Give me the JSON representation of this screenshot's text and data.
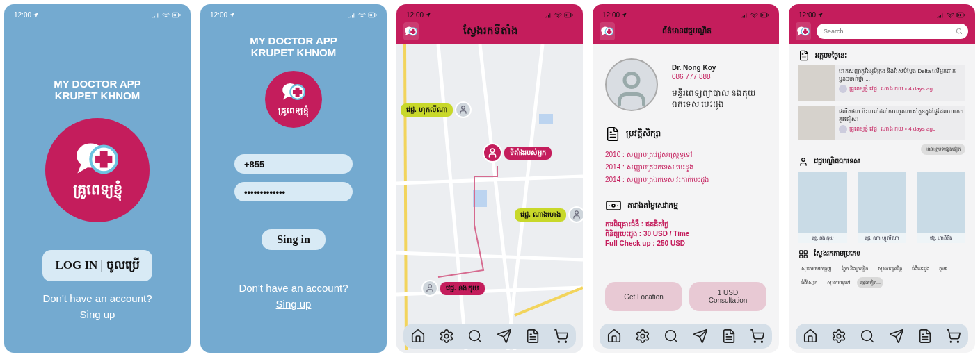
{
  "screens": [
    {
      "kind": "welcome",
      "time": "12:00",
      "title": [
        "MY DOCTOR APP",
        "KRUPET KHNOM"
      ],
      "logo_text": "គ្រូពេទ្យខ្ញុំ",
      "login_button": "LOG IN | ចូលប្រើ",
      "prompt": "Don't have an account?",
      "signup_link": "Sing up"
    },
    {
      "kind": "login",
      "time": "12:00",
      "title": [
        "MY DOCTOR APP",
        "KRUPET KHNOM"
      ],
      "logo_text": "គ្រូពេទ្យខ្ញុំ",
      "fields": [
        {
          "value": "+855"
        },
        {
          "value": "•••••••••••••"
        }
      ],
      "signin_button": "Sing in",
      "prompt": "Don't have an account?",
      "signup_link": "Sing up"
    },
    {
      "kind": "map",
      "time": "12:00",
      "header_title": "ស្វែងរកទីតាំង",
      "markers": [
        {
          "kind": "doctor",
          "label": "វេជ្ជ. ហុកលីណា",
          "color": "#c8d82a"
        },
        {
          "kind": "self",
          "label": "ទីតាំងរបស់អ្នក",
          "color": "#c41d5c"
        },
        {
          "kind": "doctor",
          "label": "វេជ្ជ. ណាងហេង",
          "color": "#c8d82a"
        },
        {
          "kind": "doctor",
          "label": "វេជ្ជ. នង កុយ",
          "color": "#c41d5c"
        }
      ]
    },
    {
      "kind": "doctor",
      "time": "12:00",
      "header_title": "ព័ត៌មានវេជ្ជបណ្ឌិត",
      "name": "Dr. Nong Koy",
      "phone": "086 777 888",
      "hospital": "មន្ទីរពេទ្យព្យាបាល នងកុយ ឯកទេស បេះដូង",
      "education": {
        "title": "ប្រវត្តិសិក្សា",
        "items": [
          "2010 : សញ្ញាបត្រវេជ្ជសាស្ត្រទូទៅ",
          "2014 : សញ្ញាបត្រឯកទេស បេះដូង",
          "2014 : សញ្ញាបត្រឯកទេស វះកាត់បេះដូង"
        ]
      },
      "prices": {
        "title": "តារាងតម្លៃសេវាកម្ម",
        "items": [
          "ការពិគ្រោះជំងឺ : ឥតគិតថ្លៃ",
          "ពិនិត្យបេះដូង : 30 USD / Time",
          "Full Check up : 250 USD"
        ]
      },
      "buttons": [
        "Get Location",
        "1 USD Consultation"
      ]
    },
    {
      "kind": "home",
      "time": "12:00",
      "search": {
        "placeholder": "Search..."
      },
      "articles": {
        "title": "អត្ថបទថ្ងៃនេះ",
        "items": [
          {
            "headline": "រោគសញ្ញាកូវីដអូមីក្រុង និងវីរុសបំប្លែង Delta លើអ្នកជាក់ ប្អូនៗចាក់ថ្នាំ ...",
            "meta": "គ្រូពេទ្យខ្ញុំ វេជ្ជ. ណាង កុយ • 4 days ago"
          },
          {
            "headline": "ផលិតផល ប៉ះពាល់ដល់ការលូតលាស់កូនក្នុងផ្ទៃដែលហាក់ៗគួរជៀស!",
            "meta": "គ្រូពេទ្យខ្ញុំ វេជ្ជ. ណាង កុយ • 4 days ago"
          }
        ],
        "more_button": "អានអត្ថបទផ្សេងទៀត"
      },
      "doctors": {
        "title": "វេជ្ជបណ្ឌិតឯកទេស",
        "items": [
          {
            "name": "វេជ្ជ. នង កុយ"
          },
          {
            "name": "វេជ្ជ. ណា ហ្វូលីណា"
          },
          {
            "name": "វេជ្ជ. ហានីជីង"
          }
        ]
      },
      "categories": {
        "title": "ស្វែងរកតាមប្រភេទ",
        "items": [
          {
            "label": "សុខភាពមាត់ធ្មេញ",
            "selected": false
          },
          {
            "label": "ភ្នែក និងត្រចៀក",
            "selected": false
          },
          {
            "label": "សុខភាពផ្លូវចិត្ត",
            "selected": false
          },
          {
            "label": "ជំងឺបេះដូង",
            "selected": false
          },
          {
            "label": "កុមារ",
            "selected": false
          },
          {
            "label": "ជំងឺស្បែក",
            "selected": false
          },
          {
            "label": "សុខភាពទូទៅ",
            "selected": false
          },
          {
            "label": "ផ្សេងទៀត...",
            "selected": true
          }
        ]
      }
    }
  ]
}
